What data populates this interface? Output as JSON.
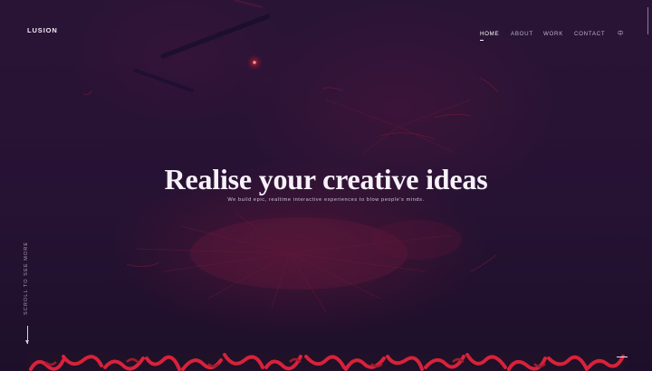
{
  "brand": {
    "logo": "LUSION"
  },
  "nav": {
    "items": [
      {
        "label": "HOME",
        "active": true
      },
      {
        "label": "ABOUT",
        "active": false
      },
      {
        "label": "WORK",
        "active": false
      },
      {
        "label": "CONTACT",
        "active": false
      }
    ],
    "language": "中"
  },
  "hero": {
    "headline": "Realise your creative ideas",
    "subline": "We build epic, realtime interactive experiences to blow people's minds."
  },
  "scroll_hint": {
    "label": "SCROLL TO SEE MORE"
  },
  "colors": {
    "background": "#231232",
    "accent_red": "#d8213a",
    "text": "#f7f2fa"
  }
}
